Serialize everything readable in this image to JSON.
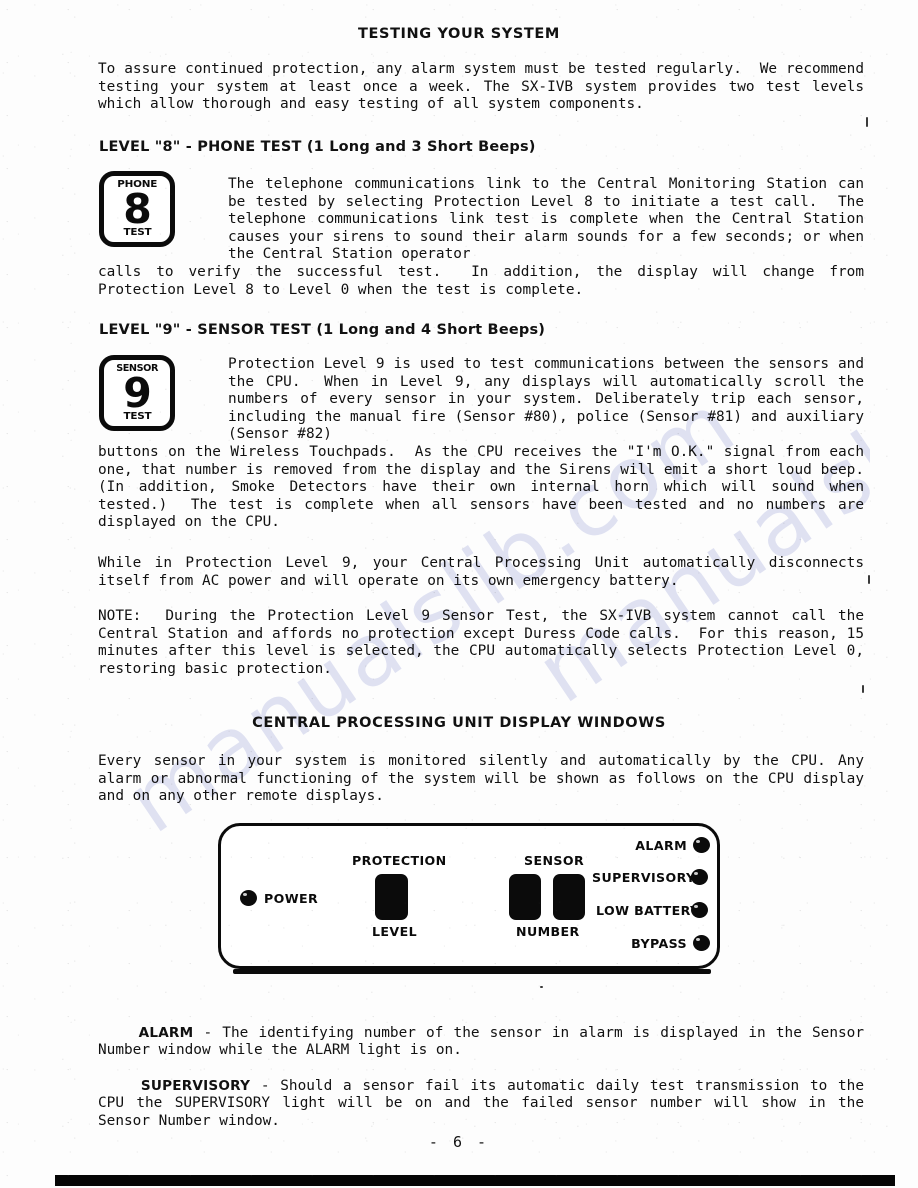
{
  "page": {
    "heading": "TESTING YOUR SYSTEM",
    "number": "- 6 -"
  },
  "intro": {
    "paragraph": "To assure continued protection, any alarm system must be tested regularly.  We recommend testing your system at least once a week. The SX-IVB system provides two test levels which allow thorough and easy testing of all system components."
  },
  "level8": {
    "subhead": "LEVEL \"8\" - PHONE TEST (1 Long and 3 Short Beeps)",
    "badge": {
      "top": "PHONE",
      "digit": "8",
      "bottom": "TEST"
    },
    "indented_text": "The telephone communications link to the Central Monitoring Station can be tested by selecting Protection Level 8 to initiate a test call.  The telephone communications link test is complete when the Central Station causes your sirens to sound their alarm sounds for a few seconds; or when the Central Station operator",
    "full_text": "calls to verify the successful test.  In addition, the display will change from Protection Level 8 to Level 0 when the test is complete."
  },
  "level9": {
    "subhead": "LEVEL \"9\" - SENSOR TEST (1 Long and 4 Short Beeps)",
    "badge": {
      "top": "SENSOR",
      "digit": "9",
      "bottom": "TEST"
    },
    "indented_text": "Protection Level 9 is used to test communications between the sensors and the CPU.  When in Level 9, any displays will automatically scroll the numbers of every sensor in your system. Deliberately trip each sensor, including the manual fire (Sensor #80), police (Sensor #81) and auxiliary (Sensor #82)",
    "full_text": "buttons on the Wireless Touchpads.  As the CPU receives the \"I'm O.K.\" signal from each one, that number is removed from the display and the Sirens will emit a short loud beep. (In addition, Smoke Detectors have their own internal horn which will sound when tested.)  The test is complete when all sensors have been tested and no numbers are displayed on the CPU.",
    "battery_note": "While in Protection Level 9, your Central Processing Unit automatically disconnects itself from AC power and will operate on its own emergency battery.",
    "note": "NOTE:  During the Protection Level 9 Sensor Test, the SX-IVB system cannot call the Central Station and affords no protection except Duress Code calls.  For this reason, 15 minutes after this level is selected, the CPU automatically selects Protection Level 0, restoring basic protection."
  },
  "cpu_section": {
    "heading": "CENTRAL PROCESSING UNIT DISPLAY WINDOWS",
    "intro": "Every sensor in your system is monitored silently and automatically by the CPU. Any alarm or abnormal functioning of the system will be shown as follows on the CPU display and on any other remote displays."
  },
  "cpu_panel": {
    "power_label": "POWER",
    "protection_label": "PROTECTION",
    "level_label": "LEVEL",
    "sensor_label": "SENSOR",
    "number_label": "NUMBER",
    "indicators": [
      {
        "label": "ALARM"
      },
      {
        "label": "SUPERVISORY"
      },
      {
        "label": "LOW BATTERY"
      },
      {
        "label": "BYPASS"
      }
    ]
  },
  "definitions": [
    {
      "term": "ALARM",
      "text": " - The identifying number of the sensor in alarm is displayed in the Sensor Number window while the ALARM light is on."
    },
    {
      "term": "SUPERVISORY",
      "text": " - Should a sensor fail its automatic daily test transmission to the CPU the SUPERVISORY light will be on and the failed sensor number will show in the Sensor Number window."
    }
  ],
  "watermark": {
    "text": "manualslib.com"
  }
}
